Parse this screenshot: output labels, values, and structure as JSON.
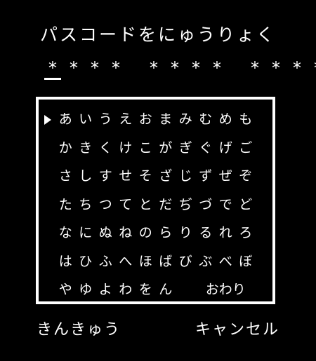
{
  "title": "パスコードをにゅうりょく",
  "password": {
    "groups": [
      [
        "*",
        "*",
        "*",
        "*"
      ],
      [
        "*",
        "*",
        "*",
        "*"
      ],
      [
        "*",
        "*",
        "*",
        "*"
      ]
    ]
  },
  "grid": {
    "rows": [
      [
        "あ",
        "い",
        "う",
        "え",
        "お",
        "ま",
        "み",
        "む",
        "め",
        "も"
      ],
      [
        "か",
        "き",
        "く",
        "け",
        "こ",
        "が",
        "ぎ",
        "ぐ",
        "げ",
        "ご"
      ],
      [
        "さ",
        "し",
        "す",
        "せ",
        "そ",
        "ざ",
        "じ",
        "ず",
        "ぜ",
        "ぞ"
      ],
      [
        "た",
        "ち",
        "つ",
        "て",
        "と",
        "だ",
        "ぢ",
        "づ",
        "で",
        "ど"
      ],
      [
        "な",
        "に",
        "ぬ",
        "ね",
        "の",
        "ら",
        "り",
        "る",
        "れ",
        "ろ"
      ],
      [
        "は",
        "ひ",
        "ふ",
        "へ",
        "ほ",
        "ば",
        "び",
        "ぶ",
        "べ",
        "ぼ"
      ],
      [
        "や",
        "ゆ",
        "よ",
        "わ",
        "を",
        "ん"
      ]
    ],
    "end_label": "おわり"
  },
  "bottom": {
    "left_label": "きんきゅう",
    "right_label": "キャンセル"
  }
}
